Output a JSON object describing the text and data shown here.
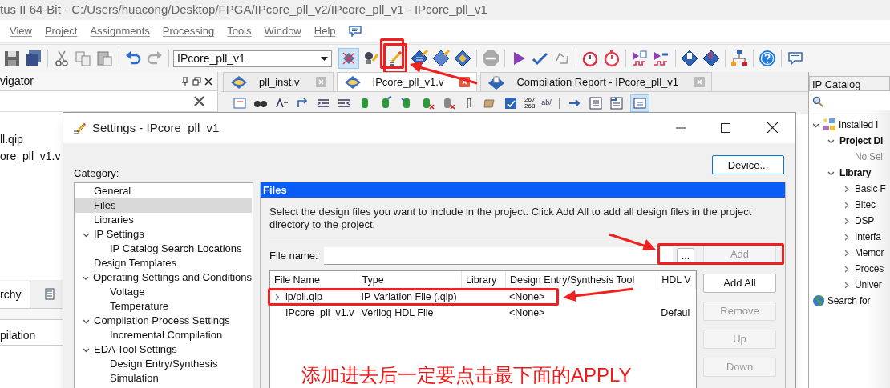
{
  "title_bar": {
    "title": "tus II 64-Bit - C:/Users/huacong/Desktop/FPGA/IPcore_pll_v2/IPcore_pll_v1 - IPcore_pll_v1"
  },
  "menu": [
    "View",
    "Project",
    "Assignments",
    "Processing",
    "Tools",
    "Window",
    "Help"
  ],
  "toolbar": {
    "project_combo": "IPcore_pll_v1"
  },
  "navigator": {
    "title": "vigator",
    "files": [
      "ll.qip",
      "ore_pll_v1.v"
    ],
    "tab": "rchy",
    "task": "pilation"
  },
  "editor_tabs": [
    {
      "label": "pll_inst.v",
      "selected": false,
      "kind": "source"
    },
    {
      "label": "IPcore_pll_v1.v",
      "selected": true,
      "kind": "source"
    },
    {
      "label": "Compilation Report - IPcore_pll_v1",
      "selected": false,
      "kind": "report"
    }
  ],
  "editor_toolbar": {
    "line_counter": [
      "267",
      "268"
    ],
    "word_icon_text": "ab/"
  },
  "ip_catalog": {
    "title": "IP Catalog",
    "tree": [
      {
        "label": "Installed I",
        "kind": "root",
        "expanded": true,
        "children": [
          {
            "label": "Project Di",
            "kind": "group",
            "expanded": true,
            "children": [
              {
                "label": "No Sel",
                "kind": "empty"
              }
            ]
          },
          {
            "label": "Library",
            "kind": "group",
            "expanded": true,
            "children": [
              {
                "label": "Basic F",
                "kind": "folder",
                "expanded": false
              },
              {
                "label": "Bitec",
                "kind": "folder",
                "expanded": false
              },
              {
                "label": "DSP",
                "kind": "folder",
                "expanded": false
              },
              {
                "label": "Interfa",
                "kind": "folder",
                "expanded": false
              },
              {
                "label": "Memor",
                "kind": "folder",
                "expanded": false
              },
              {
                "label": "Proces",
                "kind": "folder",
                "expanded": false
              },
              {
                "label": "Univer",
                "kind": "folder",
                "expanded": false
              }
            ]
          }
        ]
      },
      {
        "label": "Search for",
        "kind": "search"
      }
    ]
  },
  "dialog": {
    "title": "Settings - IPcore_pll_v1",
    "category_label": "Category:",
    "device_button": "Device...",
    "categories": [
      {
        "label": "General",
        "selected": false
      },
      {
        "label": "Files",
        "selected": true
      },
      {
        "label": "Libraries",
        "selected": false
      },
      {
        "label": "IP Settings",
        "selected": false,
        "expanded": true,
        "children": [
          {
            "label": "IP Catalog Search Locations",
            "selected": false
          }
        ]
      },
      {
        "label": "Design Templates",
        "selected": false
      },
      {
        "label": "Operating Settings and Conditions",
        "selected": false,
        "expanded": true,
        "children": [
          {
            "label": "Voltage",
            "selected": false
          },
          {
            "label": "Temperature",
            "selected": false
          }
        ]
      },
      {
        "label": "Compilation Process Settings",
        "selected": false,
        "expanded": true,
        "children": [
          {
            "label": "Incremental Compilation",
            "selected": false
          }
        ]
      },
      {
        "label": "EDA Tool Settings",
        "selected": false,
        "expanded": true,
        "children": [
          {
            "label": "Design Entry/Synthesis",
            "selected": false
          },
          {
            "label": "Simulation",
            "selected": false
          }
        ]
      }
    ],
    "panel": {
      "header": "Files",
      "description": "Select the design files you want to include in the project. Click Add All to add all design files in the project directory to the project.",
      "file_name_label": "File name:",
      "browse_button": "...",
      "buttons": [
        {
          "label": "Add",
          "disabled": true
        },
        {
          "label": "Add All",
          "disabled": false
        },
        {
          "label": "Remove",
          "disabled": true
        },
        {
          "label": "Up",
          "disabled": true
        },
        {
          "label": "Down",
          "disabled": true
        }
      ],
      "table": {
        "columns": [
          "File Name",
          "Type",
          "Library",
          "Design Entry/Synthesis Tool",
          "HDL V"
        ],
        "rows": [
          {
            "file_name": "ip/pll.qip",
            "type": "IP Variation File (.qip)",
            "tool": "<None>",
            "expandable": true
          },
          {
            "file_name": "IPcore_pll_v1.v",
            "type": "Verilog HDL File",
            "tool": "<None>",
            "hdl_version": "Defaul",
            "expandable": false
          }
        ]
      }
    }
  },
  "annotation": {
    "text": "添加进去后一定要点击最下面的APPLY"
  }
}
